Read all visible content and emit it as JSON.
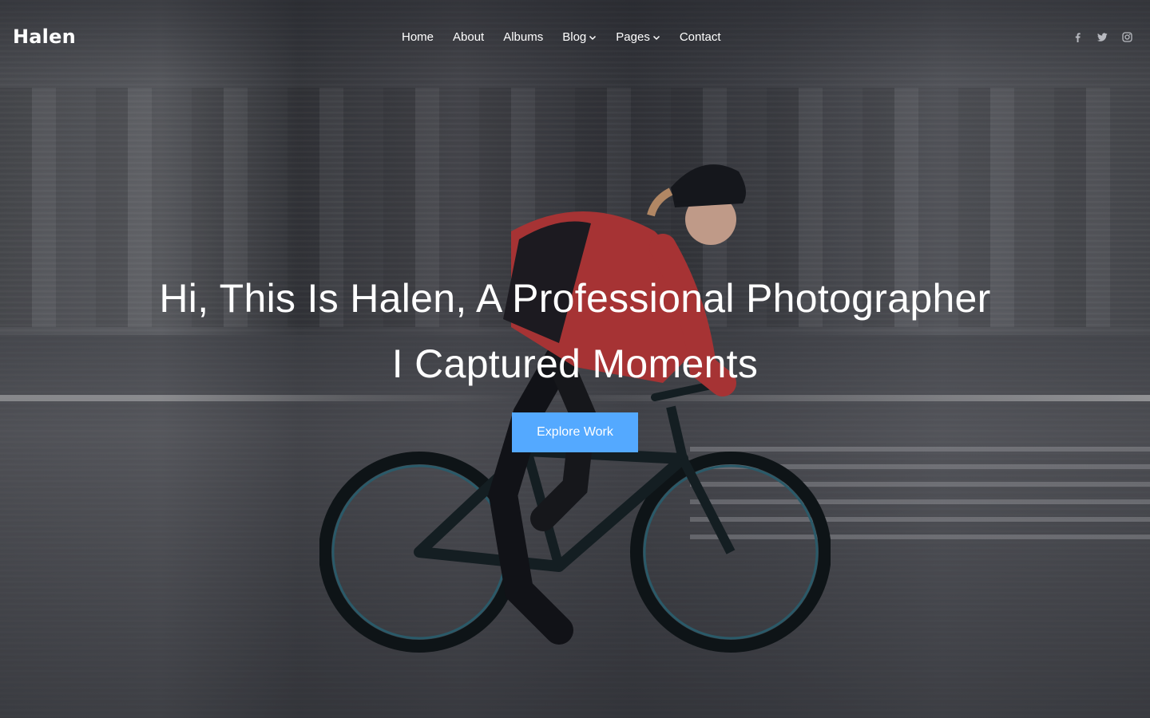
{
  "brand": {
    "logo_text": "Halen"
  },
  "nav": {
    "items": [
      {
        "label": "Home",
        "has_dropdown": false
      },
      {
        "label": "About",
        "has_dropdown": false
      },
      {
        "label": "Albums",
        "has_dropdown": false
      },
      {
        "label": "Blog",
        "has_dropdown": true
      },
      {
        "label": "Pages",
        "has_dropdown": true
      },
      {
        "label": "Contact",
        "has_dropdown": false
      }
    ]
  },
  "social": {
    "icons": [
      "facebook-icon",
      "twitter-icon",
      "instagram-icon"
    ],
    "color": "#b8bac0"
  },
  "hero": {
    "headline": "Hi, This Is Halen, A Professional Photographer",
    "subheadline": "I Captured Moments",
    "cta_label": "Explore Work",
    "cta_color": "#54a9ff"
  }
}
